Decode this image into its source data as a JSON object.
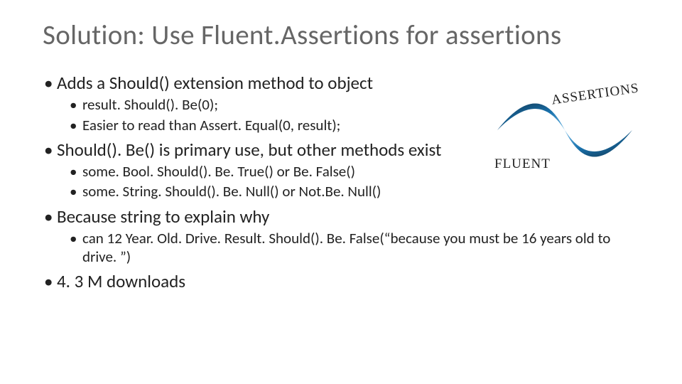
{
  "title": "Solution: Use Fluent.Assertions for assertions",
  "logo": {
    "top_label": "ASSERTIONS",
    "bottom_label": "FLUENT"
  },
  "bullets": [
    {
      "text": "Adds a Should() extension method to object",
      "children": [
        {
          "text": "result. Should(). Be(0);"
        },
        {
          "text": "Easier to read than Assert. Equal(0, result);"
        }
      ]
    },
    {
      "text": "Should(). Be() is primary use, but other methods exist",
      "children": [
        {
          "text": "some. Bool. Should(). Be. True() or Be. False()"
        },
        {
          "text": "some. String. Should(). Be. Null() or Not.Be. Null()"
        }
      ]
    },
    {
      "text": "Because string to explain why",
      "children": [
        {
          "text": "can 12 Year. Old. Drive. Result. Should(). Be. False(“because you must be 16 years old to drive. ”)"
        }
      ]
    },
    {
      "text": "4. 3 M downloads",
      "children": []
    }
  ]
}
